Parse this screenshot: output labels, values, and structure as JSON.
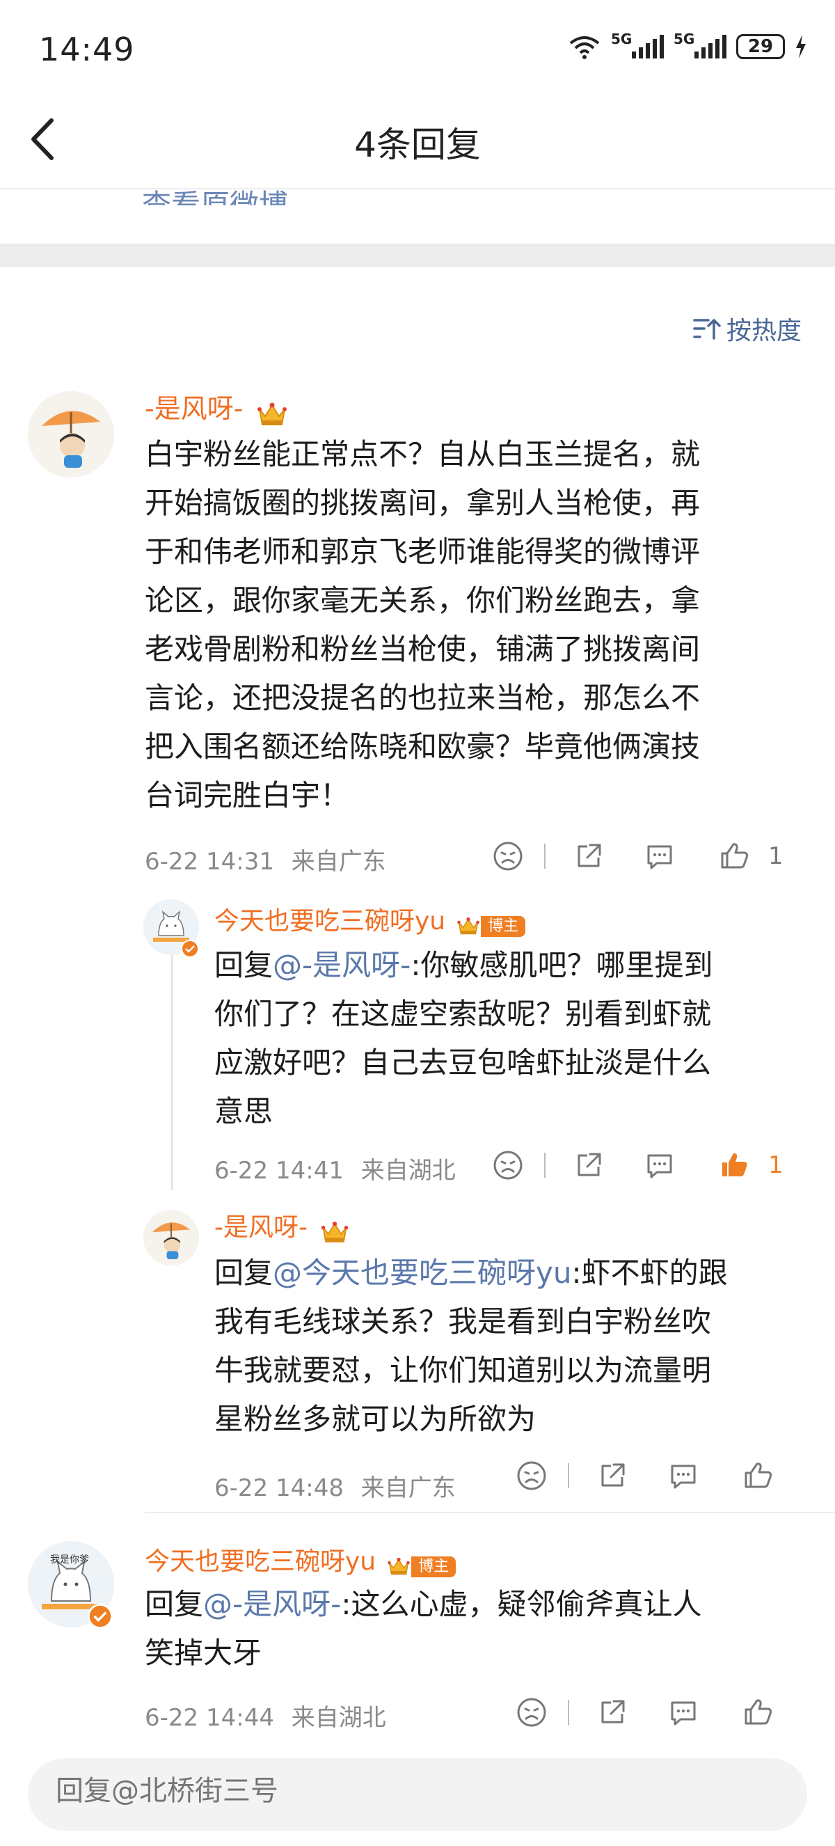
{
  "status": {
    "time": "14:49",
    "battery": "29",
    "signal1": "5G",
    "signal2": "5G"
  },
  "header": {
    "title": "4条回复",
    "view_original": "查看原微博"
  },
  "sort": {
    "label": "按热度"
  },
  "comments": [
    {
      "user": "-是风呀-",
      "text": "白宇粉丝能正常点不？自从白玉兰提名，就开始搞饭圈的挑拨离间，拿别人当枪使，再于和伟老师和郭京飞老师谁能得奖的微博评论区，跟你家毫无关系，你们粉丝跑去，拿老戏骨剧粉和粉丝当枪使，铺满了挑拨离间言论，还把没提名的也拉来当枪，那怎么不把入围名额还给陈晓和欧豪？毕竟他俩演技台词完胜白宇！",
      "lines": [
        "白宇粉丝能正常点不？自从白玉兰提名，就",
        "开始搞饭圈的挑拨离间，拿别人当枪使，再",
        "于和伟老师和郭京飞老师谁能得奖的微博评",
        "论区，跟你家毫无关系，你们粉丝跑去，拿",
        "老戏骨剧粉和粉丝当枪使，铺满了挑拨离间",
        "言论，还把没提名的也拉来当枪，那怎么不",
        "把入围名额还给陈晓和欧豪？毕竟他俩演技",
        "台词完胜白宇！"
      ],
      "time": "6-22 14:31",
      "location": "来自广东",
      "likes": "1",
      "replies": [
        {
          "user": "今天也要吃三碗呀yu",
          "badge": "博主",
          "reply_prefix": "回复",
          "mention": "@-是风呀-",
          "lines": [
            ":你敏感肌吧？哪里提到",
            "你们了？在这虚空索敌呢？别看到虾就",
            "应激好吧？自己去豆包啥虾扯淡是什么",
            "意思"
          ],
          "time": "6-22 14:41",
          "location": "来自湖北",
          "likes": "1"
        },
        {
          "user": "-是风呀-",
          "reply_prefix": "回复",
          "mention": "@今天也要吃三碗呀yu",
          "lines": [
            ":虾不虾的跟",
            "我有毛线球关系？我是看到白宇粉丝吹",
            "牛我就要怼，让你们知道别以为流量明",
            "星粉丝多就可以为所欲为"
          ],
          "time": "6-22 14:48",
          "location": "来自广东"
        }
      ]
    },
    {
      "user": "今天也要吃三碗呀yu",
      "badge": "博主",
      "avatar_text": "我是你爹",
      "reply_prefix": "回复",
      "mention": "@-是风呀-",
      "lines": [
        ":这么心虚，疑邻偷斧真让人",
        "笑掉大牙"
      ],
      "time": "6-22 14:44",
      "location": "来自湖北"
    }
  ],
  "small_avatar_text": "我是你爹",
  "reply_bar": {
    "placeholder": "回复@北桥街三号"
  },
  "colors": {
    "username": "#f06e22",
    "mention": "#5b78ac",
    "like_active": "#f07e22"
  }
}
